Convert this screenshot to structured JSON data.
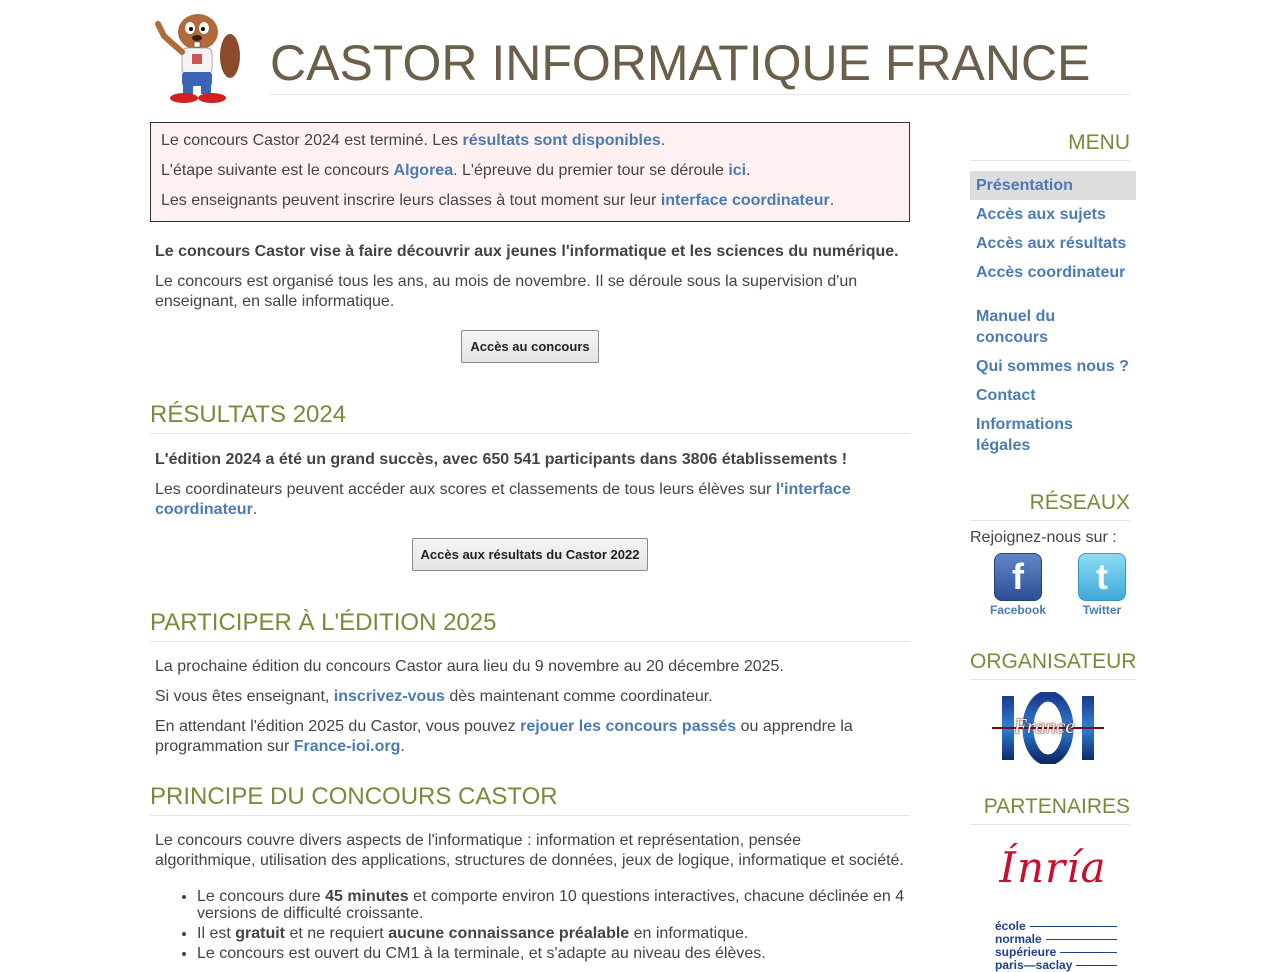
{
  "header": {
    "title": "CASTOR INFORMATIQUE FRANCE"
  },
  "notice": {
    "line1_pre": "Le concours Castor 2024 est terminé. Les ",
    "line1_link": "résultats sont disponibles",
    "line1_post": ".",
    "line2_pre": "L'étape suivante est le concours ",
    "line2_link1": "Algorea",
    "line2_mid": ". L'épreuve du premier tour se déroule ",
    "line2_link2": "ici",
    "line2_post": ".",
    "line3_pre": "Les enseignants peuvent inscrire leurs classes à tout moment sur leur ",
    "line3_link": "interface coordinateur",
    "line3_post": "."
  },
  "intro": {
    "lead": "Le concours Castor vise à faire découvrir aux jeunes l'informatique et les sciences du numérique.",
    "text": "Le concours est organisé tous les ans, au mois de novembre. Il se déroule sous la supervision d'un enseignant, en salle informatique.",
    "button": "Accès au concours"
  },
  "results": {
    "heading": "RÉSULTATS 2024",
    "lead": "L'édition 2024 a été un grand succès, avec 650 541 participants dans 3806 établissements !",
    "text_pre": "Les coordinateurs peuvent accéder aux scores et classements de tous leurs élèves sur ",
    "text_link": "l'interface coordinateur",
    "text_post": ".",
    "button": "Accès aux résultats du Castor 2022"
  },
  "participate": {
    "heading": "PARTICIPER À L'ÉDITION 2025",
    "p1": "La prochaine édition du concours Castor aura lieu du 9 novembre au 20 décembre 2025.",
    "p2_pre": "Si vous êtes enseignant, ",
    "p2_link": "inscrivez-vous",
    "p2_post": " dès maintenant comme coordinateur.",
    "p3_pre": "En attendant l'édition 2025 du Castor, vous pouvez ",
    "p3_link1": "rejouer les concours passés",
    "p3_mid": " ou apprendre la programmation sur ",
    "p3_link2": "France-ioi.org",
    "p3_post": "."
  },
  "principle": {
    "heading": "PRINCIPE DU CONCOURS CASTOR",
    "p1": "Le concours couvre divers aspects de l'informatique : information et représentation, pensée algorithmique, utilisation des applications, structures de données, jeux de logique, informatique et société.",
    "li1_pre": "Le concours dure ",
    "li1_bold": "45 minutes",
    "li1_post": " et comporte environ 10 questions interactives, chacune déclinée en 4 versions de difficulté croissante.",
    "li2_pre": "Il est ",
    "li2_bold1": "gratuit",
    "li2_mid": " et ne requiert ",
    "li2_bold2": "aucune connaissance préalable",
    "li2_post": " en informatique.",
    "li3": "Le concours est ouvert du CM1 à la terminale, et s'adapte au niveau des élèves."
  },
  "sidebar": {
    "menu_heading": "MENU",
    "menu_items": [
      "Présentation",
      "Accès aux sujets",
      "Accès aux résultats",
      "Accès coordinateur",
      "Manuel du concours",
      "Qui sommes nous ?",
      "Contact",
      "Informations légales"
    ],
    "networks_heading": "RÉSEAUX",
    "join_text": "Rejoignez-nous sur :",
    "facebook_label": "Facebook",
    "twitter_label": "Twitter",
    "organizer_heading": "ORGANISATEUR",
    "organizer_logo_text": "France",
    "partners_heading": "PARTENAIRES",
    "partner1_logo_text": "Ínría",
    "partner2_lines": [
      "école",
      "normale",
      "supérieure",
      "paris—saclay"
    ]
  },
  "colors": {
    "link": "#4a7bb5",
    "heading": "#7a8a3c",
    "title": "#6b5f4b",
    "notice_bg": "#fff1f1",
    "inria_red": "#c8102e",
    "ens_blue": "#1f3f8f"
  },
  "icons": [
    "beaver-mascot-icon",
    "facebook-icon",
    "twitter-icon"
  ]
}
